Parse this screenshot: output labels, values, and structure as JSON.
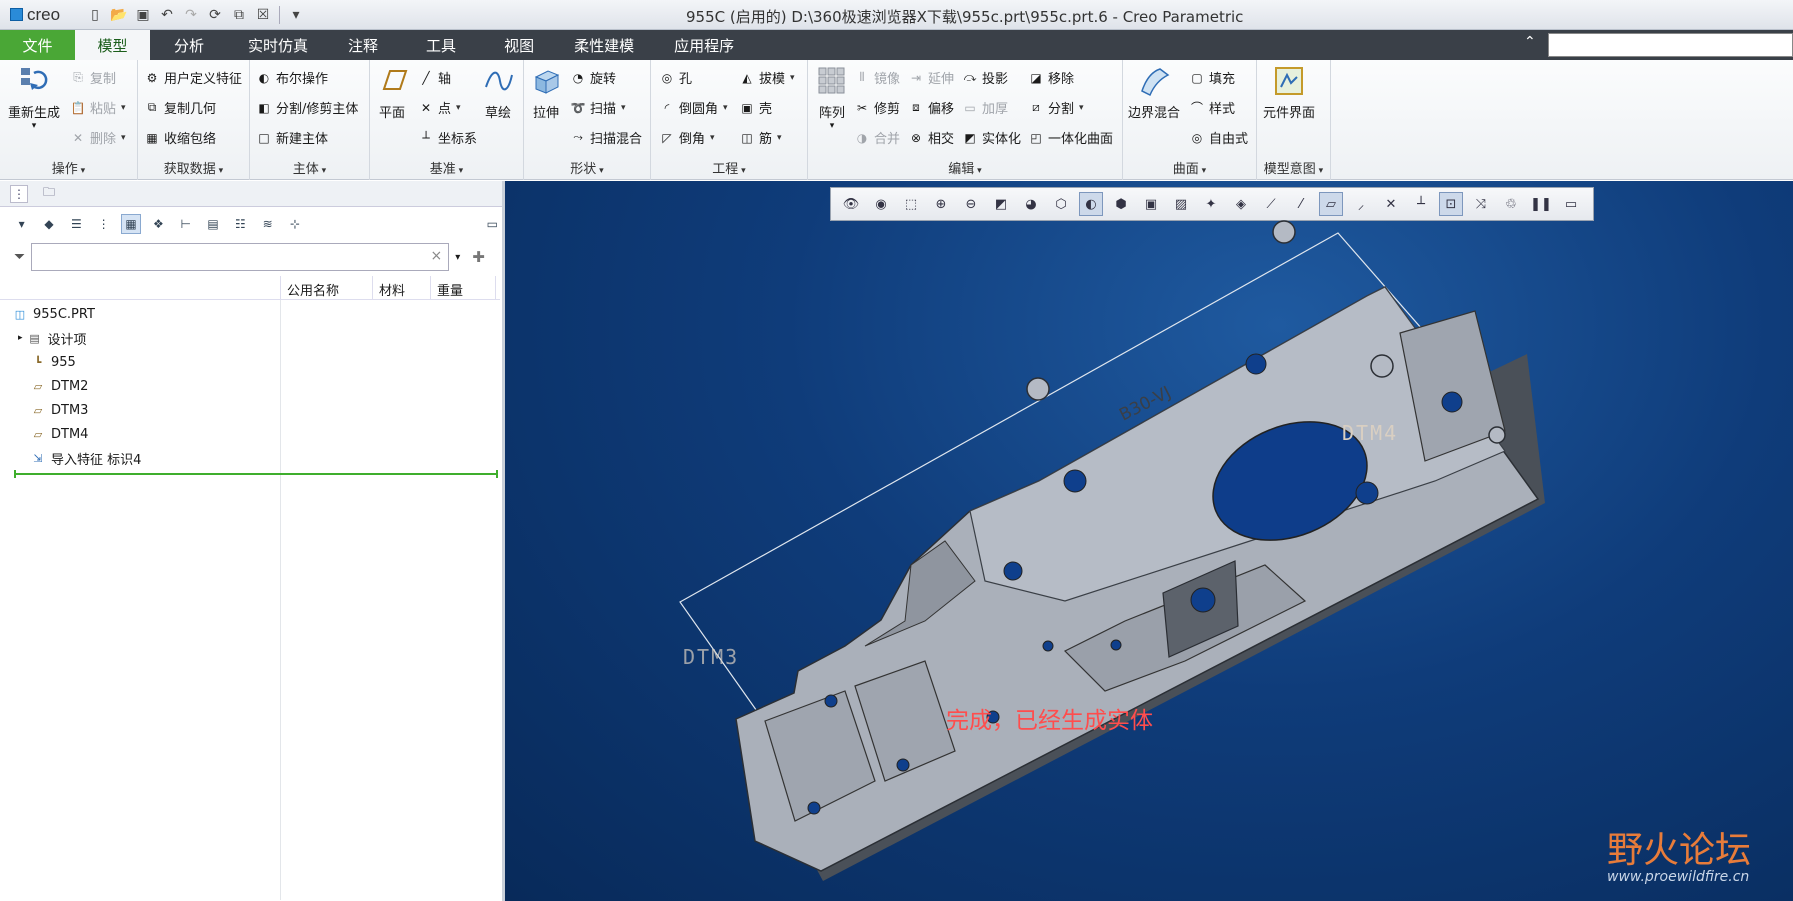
{
  "app": {
    "logo": "creo",
    "window_title": "955C (启用的) D:\\360极速浏览器X下载\\955c.prt\\955c.prt.6 - Creo Parametric"
  },
  "tabs": [
    {
      "label": "文件"
    },
    {
      "label": "模型"
    },
    {
      "label": "分析"
    },
    {
      "label": "实时仿真"
    },
    {
      "label": "注释"
    },
    {
      "label": "工具"
    },
    {
      "label": "视图"
    },
    {
      "label": "柔性建模"
    },
    {
      "label": "应用程序"
    }
  ],
  "ribbon": {
    "ops": {
      "label": "操作",
      "regen": "重新生成",
      "copy": "复制",
      "paste": "粘贴",
      "delete": "删除"
    },
    "getdata": {
      "label": "获取数据",
      "udf": "用户定义特征",
      "copygeom": "复制几何",
      "shrink": "收缩包络"
    },
    "body": {
      "label": "主体",
      "boolean": "布尔操作",
      "split": "分割/修剪主体",
      "newbody": "新建主体"
    },
    "datum": {
      "label": "基准",
      "plane": "平面",
      "axis": "轴",
      "point": "点",
      "csys": "坐标系",
      "sketch": "草绘"
    },
    "shape": {
      "label": "形状",
      "extrude": "拉伸",
      "revolve": "旋转",
      "sweep": "扫描",
      "sweepblend": "扫描混合"
    },
    "eng": {
      "label": "工程",
      "hole": "孔",
      "round": "倒圆角",
      "chamfer": "倒角",
      "draft": "拔模",
      "shell": "壳",
      "rib": "筋"
    },
    "edit": {
      "label": "编辑",
      "pattern": "阵列",
      "mirror": "镜像",
      "extend": "延伸",
      "project": "投影",
      "remove": "移除",
      "trim": "修剪",
      "offset": "偏移",
      "thicken": "加厚",
      "split": "分割",
      "merge": "合并",
      "intersect": "相交",
      "solidify": "实体化",
      "unify": "一体化曲面"
    },
    "surface": {
      "label": "曲面",
      "boundary": "边界混合",
      "fill": "填充",
      "style": "样式",
      "freestyle": "自由式"
    },
    "intent": {
      "label": "模型意图",
      "compiface": "元件界面"
    }
  },
  "tree": {
    "columns": [
      "公用名称",
      "材料",
      "重量"
    ],
    "items": [
      {
        "label": "955C.PRT",
        "icon": "part-icon"
      },
      {
        "label": "设计项",
        "icon": "design-items-icon"
      },
      {
        "label": "955",
        "icon": "csys-icon"
      },
      {
        "label": "DTM2",
        "icon": "datum-plane-icon"
      },
      {
        "label": "DTM3",
        "icon": "datum-plane-icon"
      },
      {
        "label": "DTM4",
        "icon": "datum-plane-icon"
      },
      {
        "label": "导入特征 标识4",
        "icon": "import-feature-icon"
      }
    ]
  },
  "graphics": {
    "annotation": "完成，已经生成实体",
    "datum_labels": [
      "DTM4",
      "DTM3"
    ],
    "part_engraving": "B30-VJ",
    "watermark": "野火论坛",
    "watermark_url": "www.proewildfire.cn"
  },
  "colors": {
    "file_tab": "#4aa736",
    "tab_bar": "#3a4048",
    "annotation": "#ff4d4d",
    "background": "#0f3c7a"
  }
}
